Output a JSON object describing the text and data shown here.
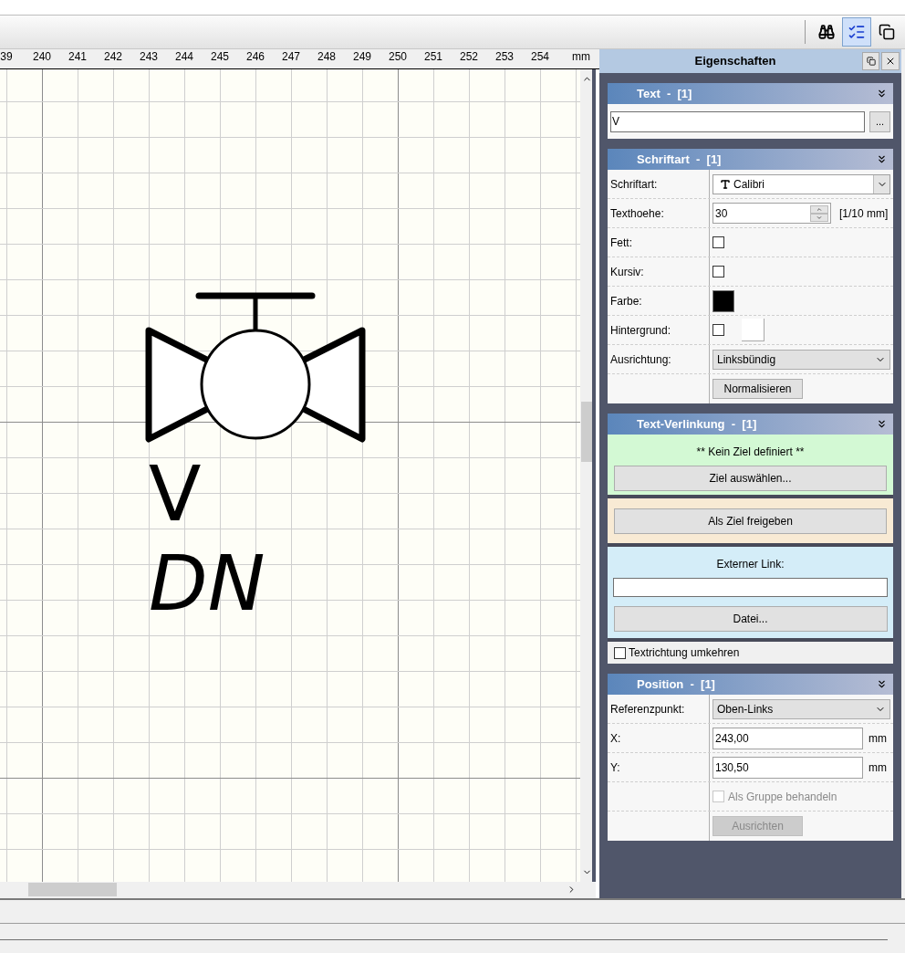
{
  "toolbar": {
    "buttons": [
      {
        "kind": "binoculars",
        "selected": false
      },
      {
        "kind": "checklist",
        "selected": true
      },
      {
        "kind": "copy",
        "selected": false
      }
    ]
  },
  "ruler": {
    "labels": [
      "39",
      "240",
      "241",
      "242",
      "243",
      "244",
      "245",
      "246",
      "247",
      "248",
      "249",
      "250",
      "251",
      "252",
      "253",
      "254"
    ],
    "unit": "mm"
  },
  "canvas": {
    "texts": [
      {
        "text": "V",
        "italic": false
      },
      {
        "text": "DN",
        "italic": true
      }
    ]
  },
  "panel": {
    "title": "Eigenschaften",
    "sections": [
      {
        "kind": "text",
        "title": "Text  -  [1]",
        "expanded": true,
        "value": "V",
        "button": "..."
      },
      {
        "kind": "grid",
        "title": "Schriftart  -  [1]",
        "expanded": true,
        "rows": [
          {
            "kind": "font",
            "label": "Schriftart:",
            "value": "Calibri"
          },
          {
            "kind": "number",
            "label": "Texthoehe:",
            "value": "30",
            "unit": "[1/10 mm]"
          },
          {
            "kind": "checkbox",
            "label": "Fett:",
            "checked": false
          },
          {
            "kind": "checkbox",
            "label": "Kursiv:",
            "checked": false
          },
          {
            "kind": "color",
            "label": "Farbe:",
            "color": "#000000"
          },
          {
            "kind": "checkcolor",
            "label": "Hintergrund:",
            "checked": false,
            "color": "#ffffff"
          },
          {
            "kind": "select",
            "label": "Ausrichtung:",
            "value": "Linksbündig"
          },
          {
            "kind": "button",
            "value": "Normalisieren",
            "disabled": false
          }
        ]
      },
      {
        "kind": "link",
        "title": "Text-Verlinkung  -  [1]",
        "expanded": true,
        "status": "** Kein Ziel definiert **",
        "target_button": "Ziel auswählen...",
        "share_button": "Als Ziel freigeben",
        "external_label": "Externer Link:",
        "file_button": "Datei...",
        "reverse": {
          "label": "Textrichtung umkehren",
          "checked": false
        }
      },
      {
        "kind": "grid",
        "title": "Position  -  [1]",
        "expanded": true,
        "rows": [
          {
            "kind": "select",
            "label": "Referenzpunkt:",
            "value": "Oben-Links"
          },
          {
            "kind": "field",
            "label": "X:",
            "value": "243,00",
            "unit": "mm"
          },
          {
            "kind": "field",
            "label": "Y:",
            "value": "130,50",
            "unit": "mm"
          },
          {
            "kind": "inlinecheck",
            "value": "Als Gruppe behandeln",
            "checked": false,
            "disabled": true
          },
          {
            "kind": "button",
            "value": "Ausrichten",
            "disabled": true
          }
        ]
      }
    ]
  }
}
